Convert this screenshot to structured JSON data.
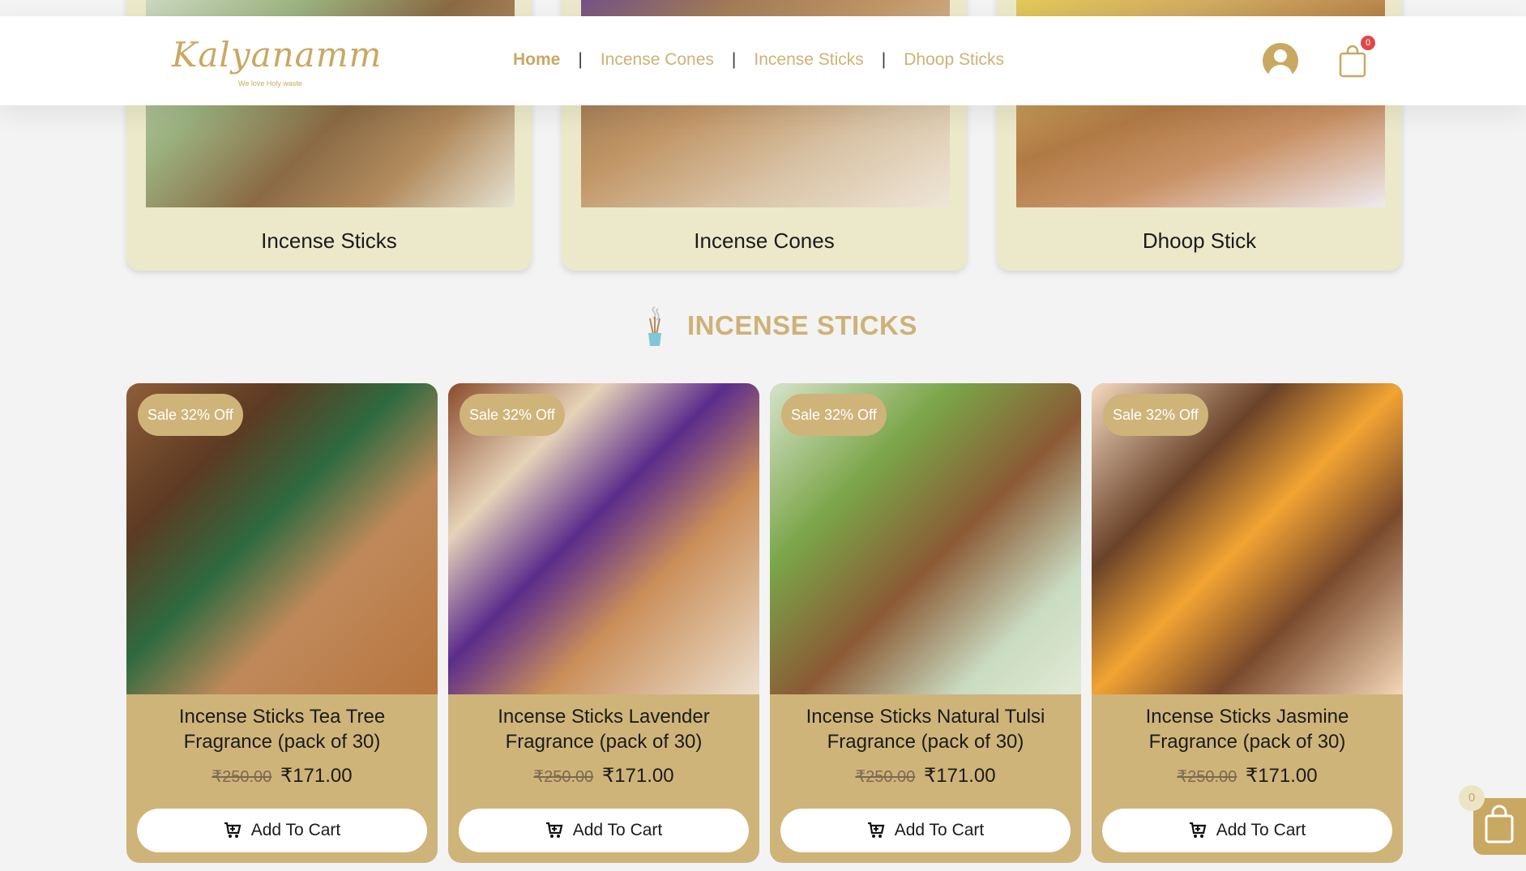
{
  "brand": {
    "logo_text": "Kalyanamm",
    "tagline": "We love Holy waste"
  },
  "nav": {
    "items": [
      {
        "label": "Home",
        "active": true
      },
      {
        "label": "Incense Cones",
        "active": false
      },
      {
        "label": "Incense Sticks",
        "active": false
      },
      {
        "label": "Dhoop Sticks",
        "active": false
      }
    ],
    "separator": "|"
  },
  "header_actions": {
    "user_icon": "user-icon",
    "cart_icon": "shopping-bag-icon",
    "cart_count": "0"
  },
  "categories": [
    {
      "title": "Incense Sticks"
    },
    {
      "title": "Incense Cones"
    },
    {
      "title": "Dhoop Stick"
    }
  ],
  "section": {
    "title": "INCENSE STICKS",
    "icon": "incense-icon"
  },
  "products": [
    {
      "sale": "Sale 32% Off",
      "name": "Incense Sticks Tea Tree Fragrance (pack of 30)",
      "old_price": "₹250.00",
      "price": "₹171.00",
      "button": "Add To Cart"
    },
    {
      "sale": "Sale 32% Off",
      "name": "Incense Sticks Lavender Fragrance (pack of 30)",
      "old_price": "₹250.00",
      "price": "₹171.00",
      "button": "Add To Cart"
    },
    {
      "sale": "Sale 32% Off",
      "name": "Incense Sticks Natural Tulsi Fragrance (pack of 30)",
      "old_price": "₹250.00",
      "price": "₹171.00",
      "button": "Add To Cart"
    },
    {
      "sale": "Sale 32% Off",
      "name": "Incense Sticks Jasmine Fragrance (pack of 30)",
      "old_price": "₹250.00",
      "price": "₹171.00",
      "button": "Add To Cart"
    }
  ],
  "floating_cart": {
    "count": "0"
  },
  "colors": {
    "gold": "#cfb47a",
    "accent": "#c9a862",
    "card_bg": "#ebe9c9",
    "page_bg": "#f3f3f3",
    "badge_red": "#e04848"
  }
}
